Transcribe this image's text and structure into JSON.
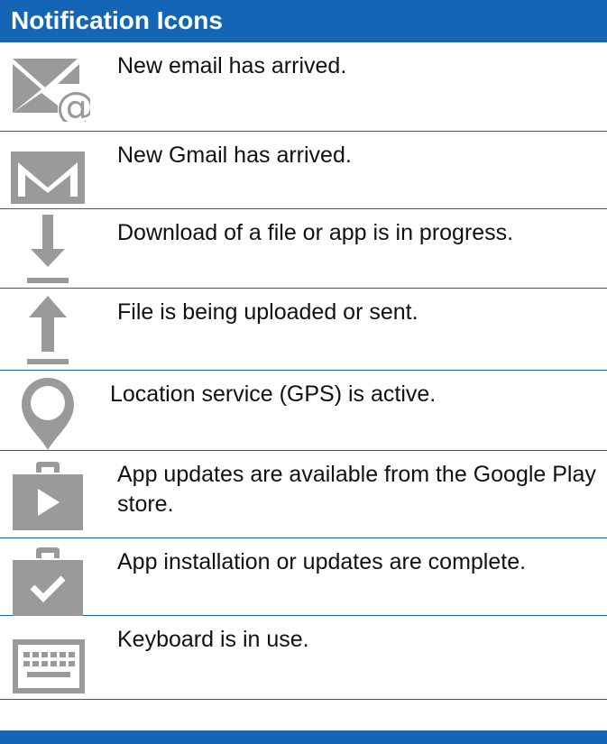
{
  "header": {
    "title": "Notification Icons"
  },
  "colors": {
    "accent": "#1565b6",
    "icon": "#9a9a9a",
    "text": "#111111"
  },
  "rows": [
    {
      "icon": "email-icon",
      "text": "New email has arrived."
    },
    {
      "icon": "gmail-icon",
      "text": "New Gmail has arrived."
    },
    {
      "icon": "download-icon",
      "text": "Download of a file or app is in progress."
    },
    {
      "icon": "upload-icon",
      "text": "File is being uploaded or sent."
    },
    {
      "icon": "location-icon",
      "text": "Location service (GPS) is active."
    },
    {
      "icon": "play-store-update-icon",
      "text": "App updates are available from the Google Play store."
    },
    {
      "icon": "app-install-complete-icon",
      "text": "App installation or updates are complete."
    },
    {
      "icon": "keyboard-icon",
      "text": "Keyboard is in use."
    }
  ]
}
